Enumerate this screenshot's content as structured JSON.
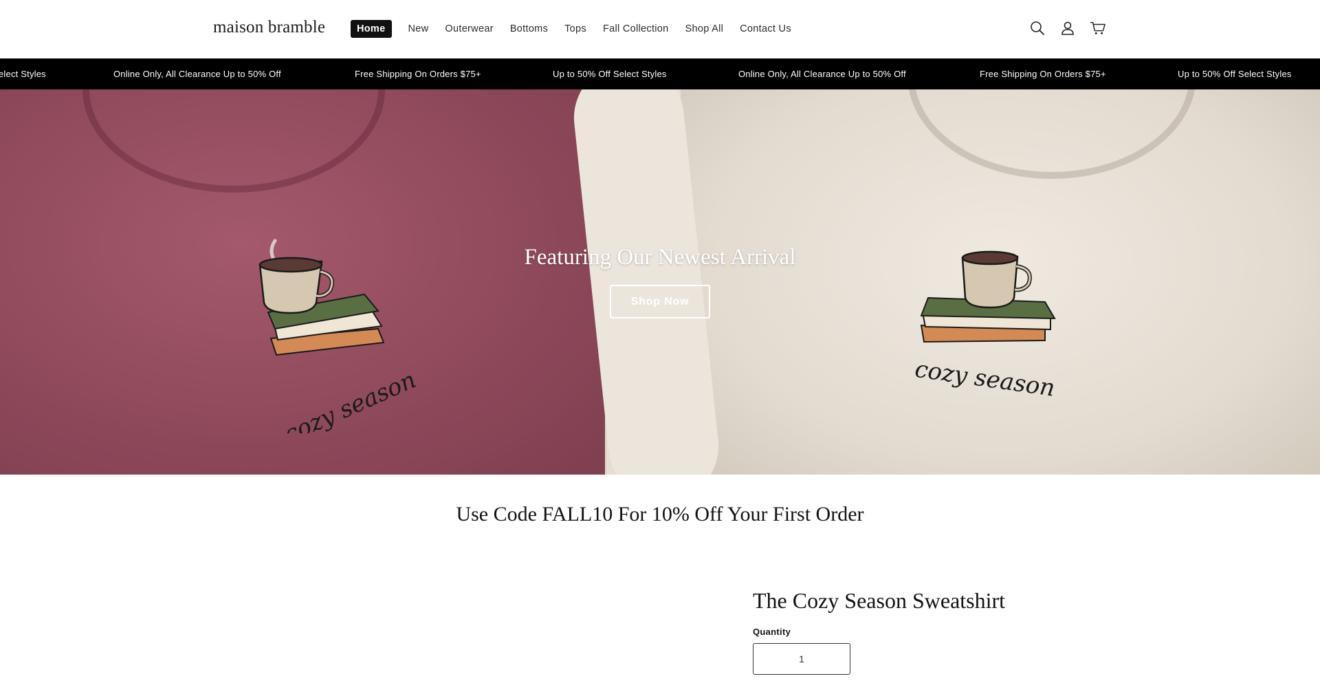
{
  "header": {
    "logo": "maison bramble",
    "nav": [
      "Home",
      "New",
      "Outerwear",
      "Bottoms",
      "Tops",
      "Fall Collection",
      "Shop All",
      "Contact Us"
    ],
    "active_nav": "Home",
    "icons": [
      "search-icon",
      "account-icon",
      "cart-icon"
    ]
  },
  "announcement": {
    "items": [
      "elect Styles",
      "Online Only, All Clearance Up to 50% Off",
      "Free Shipping On Orders $75+",
      "Up to 50% Off Select Styles",
      "Online Only, All Clearance Up to 50% Off",
      "Free Shipping On Orders $75+",
      "Up to 50% Off Select Styles"
    ]
  },
  "hero": {
    "title": "Featuring Our Newest Arrival",
    "cta": "Shop Now",
    "shirt_text": "cozy season",
    "colors": {
      "left_shirt": "#8f4a5b",
      "right_shirt": "#e6ddd1"
    }
  },
  "promo": {
    "text": "Use Code FALL10 For 10% Off Your First Order"
  },
  "product": {
    "title": "The Cozy Season Sweatshirt",
    "quantity_label": "Quantity",
    "quantity_value": "1"
  }
}
